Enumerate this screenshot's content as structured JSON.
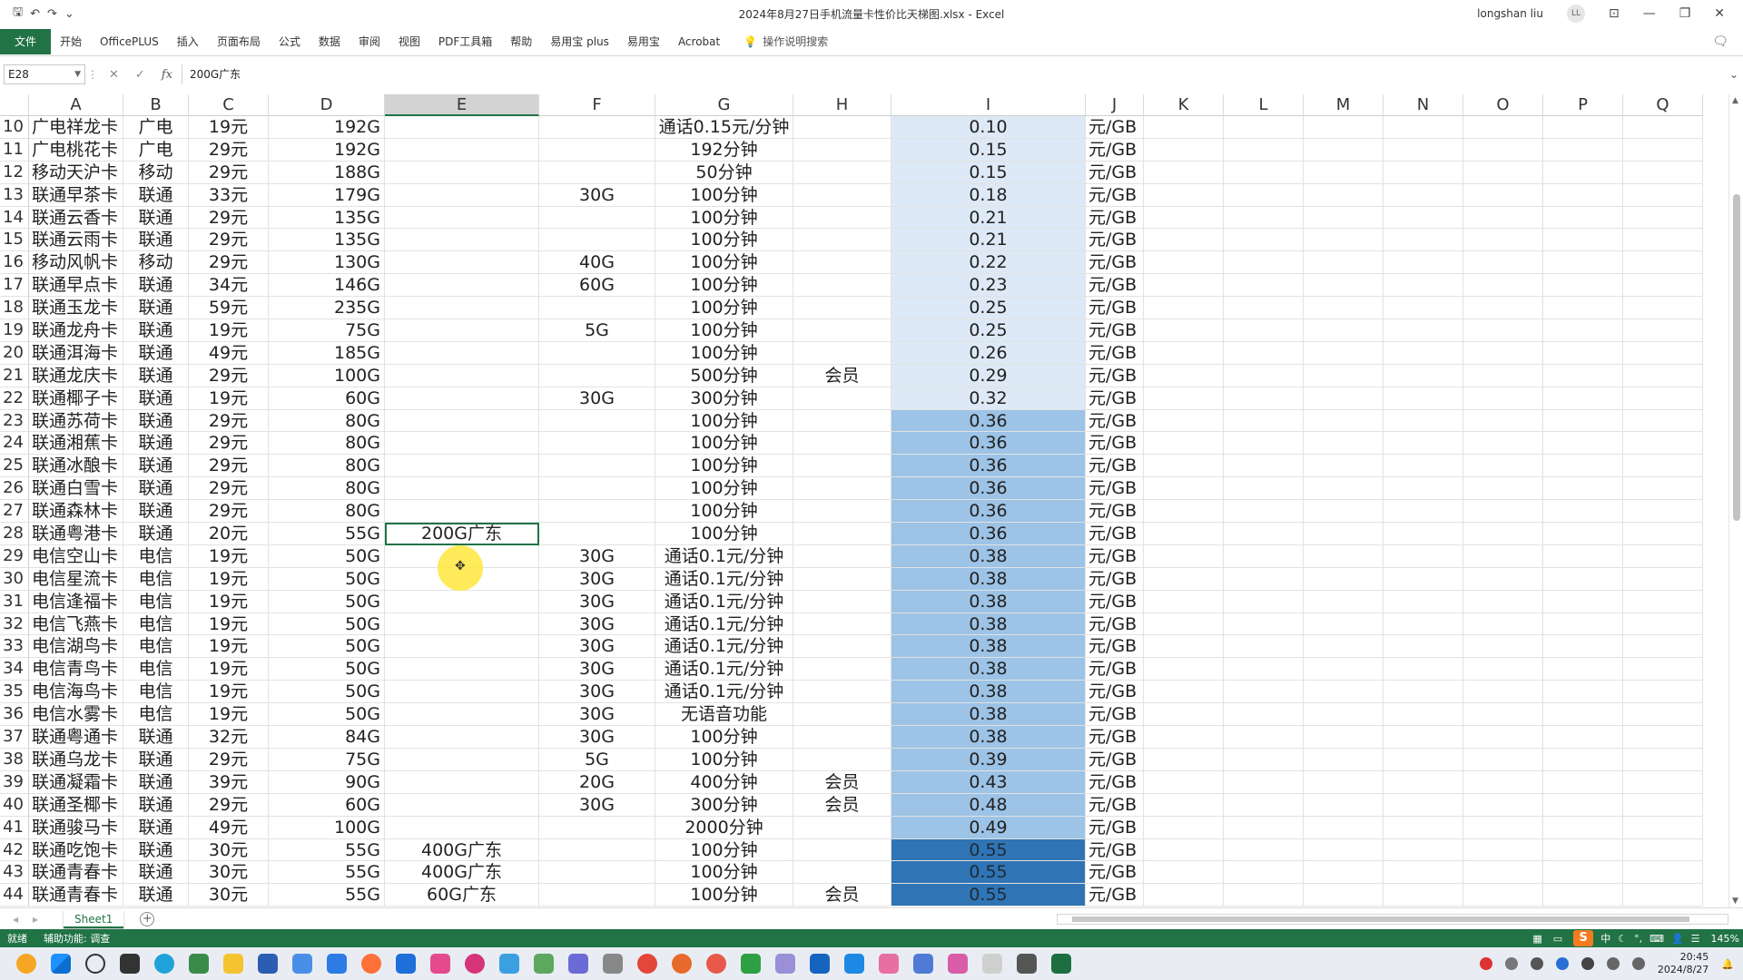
{
  "titlebar": {
    "document_title": "2024年8月27日手机流量卡性价比天梯图.xlsx  -  Excel",
    "user_name": "longshan liu",
    "user_initials": "LL",
    "qat_icons": [
      "save-icon",
      "undo-icon",
      "redo-icon",
      "customize-icon"
    ]
  },
  "ribbon": {
    "tabs": [
      "文件",
      "开始",
      "OfficePLUS",
      "插入",
      "页面布局",
      "公式",
      "数据",
      "审阅",
      "视图",
      "PDF工具箱",
      "帮助",
      "易用宝 plus",
      "易用宝",
      "Acrobat"
    ],
    "tell_me": "操作说明搜索"
  },
  "formula_bar": {
    "name_box": "E28",
    "formula": "200G广东"
  },
  "columns": [
    "A",
    "B",
    "C",
    "D",
    "E",
    "F",
    "G",
    "H",
    "I",
    "J",
    "K",
    "L",
    "M",
    "N",
    "O",
    "P",
    "Q"
  ],
  "selected_column": "E",
  "rows": [
    {
      "n": "10",
      "A": "广电祥龙卡",
      "B": "广电",
      "C": "19元",
      "D": "192G",
      "E": "",
      "F": "",
      "G": "通话0.15元/分钟",
      "H": "",
      "I": "0.10",
      "J": "元/GB",
      "shade": 1
    },
    {
      "n": "11",
      "A": "广电桃花卡",
      "B": "广电",
      "C": "29元",
      "D": "192G",
      "E": "",
      "F": "",
      "G": "192分钟",
      "H": "",
      "I": "0.15",
      "J": "元/GB",
      "shade": 1
    },
    {
      "n": "12",
      "A": "移动天沪卡",
      "B": "移动",
      "C": "29元",
      "D": "188G",
      "E": "",
      "F": "",
      "G": "50分钟",
      "H": "",
      "I": "0.15",
      "J": "元/GB",
      "shade": 1
    },
    {
      "n": "13",
      "A": "联通早茶卡",
      "B": "联通",
      "C": "33元",
      "D": "179G",
      "E": "",
      "F": "30G",
      "G": "100分钟",
      "H": "",
      "I": "0.18",
      "J": "元/GB",
      "shade": 1
    },
    {
      "n": "14",
      "A": "联通云香卡",
      "B": "联通",
      "C": "29元",
      "D": "135G",
      "E": "",
      "F": "",
      "G": "100分钟",
      "H": "",
      "I": "0.21",
      "J": "元/GB",
      "shade": 1
    },
    {
      "n": "15",
      "A": "联通云雨卡",
      "B": "联通",
      "C": "29元",
      "D": "135G",
      "E": "",
      "F": "",
      "G": "100分钟",
      "H": "",
      "I": "0.21",
      "J": "元/GB",
      "shade": 1
    },
    {
      "n": "16",
      "A": "移动风帆卡",
      "B": "移动",
      "C": "29元",
      "D": "130G",
      "E": "",
      "F": "40G",
      "G": "100分钟",
      "H": "",
      "I": "0.22",
      "J": "元/GB",
      "shade": 1
    },
    {
      "n": "17",
      "A": "联通早点卡",
      "B": "联通",
      "C": "34元",
      "D": "146G",
      "E": "",
      "F": "60G",
      "G": "100分钟",
      "H": "",
      "I": "0.23",
      "J": "元/GB",
      "shade": 1
    },
    {
      "n": "18",
      "A": "联通玉龙卡",
      "B": "联通",
      "C": "59元",
      "D": "235G",
      "E": "",
      "F": "",
      "G": "100分钟",
      "H": "",
      "I": "0.25",
      "J": "元/GB",
      "shade": 1
    },
    {
      "n": "19",
      "A": "联通龙舟卡",
      "B": "联通",
      "C": "19元",
      "D": "75G",
      "E": "",
      "F": "5G",
      "G": "100分钟",
      "H": "",
      "I": "0.25",
      "J": "元/GB",
      "shade": 1
    },
    {
      "n": "20",
      "A": "联通洱海卡",
      "B": "联通",
      "C": "49元",
      "D": "185G",
      "E": "",
      "F": "",
      "G": "100分钟",
      "H": "",
      "I": "0.26",
      "J": "元/GB",
      "shade": 1
    },
    {
      "n": "21",
      "A": "联通龙庆卡",
      "B": "联通",
      "C": "29元",
      "D": "100G",
      "E": "",
      "F": "",
      "G": "500分钟",
      "H": "会员",
      "I": "0.29",
      "J": "元/GB",
      "shade": 1
    },
    {
      "n": "22",
      "A": "联通椰子卡",
      "B": "联通",
      "C": "19元",
      "D": "60G",
      "E": "",
      "F": "30G",
      "G": "300分钟",
      "H": "",
      "I": "0.32",
      "J": "元/GB",
      "shade": 1
    },
    {
      "n": "23",
      "A": "联通苏荷卡",
      "B": "联通",
      "C": "29元",
      "D": "80G",
      "E": "",
      "F": "",
      "G": "100分钟",
      "H": "",
      "I": "0.36",
      "J": "元/GB",
      "shade": 2
    },
    {
      "n": "24",
      "A": "联通湘蕉卡",
      "B": "联通",
      "C": "29元",
      "D": "80G",
      "E": "",
      "F": "",
      "G": "100分钟",
      "H": "",
      "I": "0.36",
      "J": "元/GB",
      "shade": 2
    },
    {
      "n": "25",
      "A": "联通冰酿卡",
      "B": "联通",
      "C": "29元",
      "D": "80G",
      "E": "",
      "F": "",
      "G": "100分钟",
      "H": "",
      "I": "0.36",
      "J": "元/GB",
      "shade": 2
    },
    {
      "n": "26",
      "A": "联通白雪卡",
      "B": "联通",
      "C": "29元",
      "D": "80G",
      "E": "",
      "F": "",
      "G": "100分钟",
      "H": "",
      "I": "0.36",
      "J": "元/GB",
      "shade": 2
    },
    {
      "n": "27",
      "A": "联通森林卡",
      "B": "联通",
      "C": "29元",
      "D": "80G",
      "E": "",
      "F": "",
      "G": "100分钟",
      "H": "",
      "I": "0.36",
      "J": "元/GB",
      "shade": 2
    },
    {
      "n": "28",
      "A": "联通粤港卡",
      "B": "联通",
      "C": "20元",
      "D": "55G",
      "E": "200G广东",
      "F": "",
      "G": "100分钟",
      "H": "",
      "I": "0.36",
      "J": "元/GB",
      "shade": 2
    },
    {
      "n": "29",
      "A": "电信空山卡",
      "B": "电信",
      "C": "19元",
      "D": "50G",
      "E": "",
      "F": "30G",
      "G": "通话0.1元/分钟",
      "H": "",
      "I": "0.38",
      "J": "元/GB",
      "shade": 2
    },
    {
      "n": "30",
      "A": "电信星流卡",
      "B": "电信",
      "C": "19元",
      "D": "50G",
      "E": "",
      "F": "30G",
      "G": "通话0.1元/分钟",
      "H": "",
      "I": "0.38",
      "J": "元/GB",
      "shade": 2
    },
    {
      "n": "31",
      "A": "电信逢福卡",
      "B": "电信",
      "C": "19元",
      "D": "50G",
      "E": "",
      "F": "30G",
      "G": "通话0.1元/分钟",
      "H": "",
      "I": "0.38",
      "J": "元/GB",
      "shade": 2
    },
    {
      "n": "32",
      "A": "电信飞燕卡",
      "B": "电信",
      "C": "19元",
      "D": "50G",
      "E": "",
      "F": "30G",
      "G": "通话0.1元/分钟",
      "H": "",
      "I": "0.38",
      "J": "元/GB",
      "shade": 2
    },
    {
      "n": "33",
      "A": "电信湖鸟卡",
      "B": "电信",
      "C": "19元",
      "D": "50G",
      "E": "",
      "F": "30G",
      "G": "通话0.1元/分钟",
      "H": "",
      "I": "0.38",
      "J": "元/GB",
      "shade": 2
    },
    {
      "n": "34",
      "A": "电信青鸟卡",
      "B": "电信",
      "C": "19元",
      "D": "50G",
      "E": "",
      "F": "30G",
      "G": "通话0.1元/分钟",
      "H": "",
      "I": "0.38",
      "J": "元/GB",
      "shade": 2
    },
    {
      "n": "35",
      "A": "电信海鸟卡",
      "B": "电信",
      "C": "19元",
      "D": "50G",
      "E": "",
      "F": "30G",
      "G": "通话0.1元/分钟",
      "H": "",
      "I": "0.38",
      "J": "元/GB",
      "shade": 2
    },
    {
      "n": "36",
      "A": "电信水雾卡",
      "B": "电信",
      "C": "19元",
      "D": "50G",
      "E": "",
      "F": "30G",
      "G": "无语音功能",
      "H": "",
      "I": "0.38",
      "J": "元/GB",
      "shade": 2
    },
    {
      "n": "37",
      "A": "联通粤通卡",
      "B": "联通",
      "C": "32元",
      "D": "84G",
      "E": "",
      "F": "30G",
      "G": "100分钟",
      "H": "",
      "I": "0.38",
      "J": "元/GB",
      "shade": 2
    },
    {
      "n": "38",
      "A": "联通乌龙卡",
      "B": "联通",
      "C": "29元",
      "D": "75G",
      "E": "",
      "F": "5G",
      "G": "100分钟",
      "H": "",
      "I": "0.39",
      "J": "元/GB",
      "shade": 2
    },
    {
      "n": "39",
      "A": "联通凝霜卡",
      "B": "联通",
      "C": "39元",
      "D": "90G",
      "E": "",
      "F": "20G",
      "G": "400分钟",
      "H": "会员",
      "I": "0.43",
      "J": "元/GB",
      "shade": 2
    },
    {
      "n": "40",
      "A": "联通圣椰卡",
      "B": "联通",
      "C": "29元",
      "D": "60G",
      "E": "",
      "F": "30G",
      "G": "300分钟",
      "H": "会员",
      "I": "0.48",
      "J": "元/GB",
      "shade": 2
    },
    {
      "n": "41",
      "A": "联通骏马卡",
      "B": "联通",
      "C": "49元",
      "D": "100G",
      "E": "",
      "F": "",
      "G": "2000分钟",
      "H": "",
      "I": "0.49",
      "J": "元/GB",
      "shade": 2
    },
    {
      "n": "42",
      "A": "联通吃饱卡",
      "B": "联通",
      "C": "30元",
      "D": "55G",
      "E": "400G广东",
      "F": "",
      "G": "100分钟",
      "H": "",
      "I": "0.55",
      "J": "元/GB",
      "shade": 3
    },
    {
      "n": "43",
      "A": "联通青春卡",
      "B": "联通",
      "C": "30元",
      "D": "55G",
      "E": "400G广东",
      "F": "",
      "G": "100分钟",
      "H": "",
      "I": "0.55",
      "J": "元/GB",
      "shade": 3
    },
    {
      "n": "44",
      "A": "联通青春卡",
      "B": "联通",
      "C": "30元",
      "D": "55G",
      "E": "60G广东",
      "F": "",
      "G": "100分钟",
      "H": "会员",
      "I": "0.55",
      "J": "元/GB",
      "shade": 3
    }
  ],
  "active_cell": {
    "row": "28",
    "col": "E"
  },
  "sheet_tabs": [
    "Sheet1"
  ],
  "status_bar": {
    "ready": "就绪",
    "accessibility": "辅助功能: 调查",
    "zoom": "145%"
  },
  "ime": {
    "logo": "S",
    "mode": "中"
  },
  "taskbar": {
    "time": "20:45",
    "date": "2024/8/27"
  },
  "colors": {
    "excel_green": "#217346",
    "shade_light": "#dde9f6",
    "shade_mid": "#9dc3e6",
    "shade_dark": "#2f75b5"
  }
}
